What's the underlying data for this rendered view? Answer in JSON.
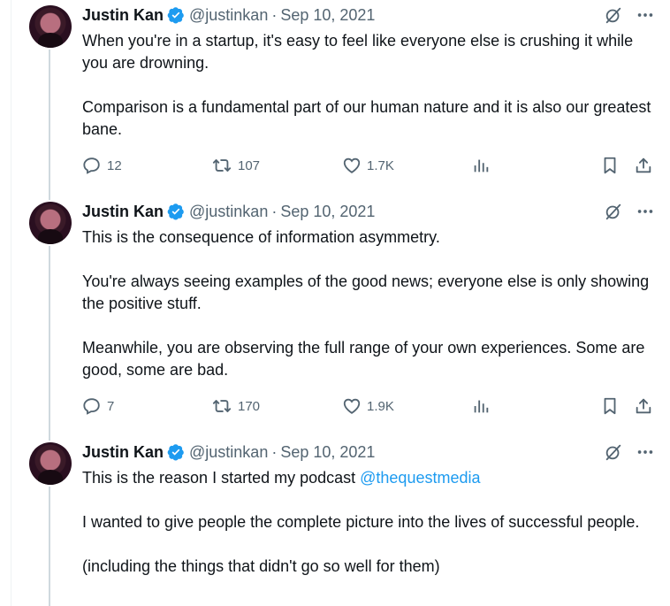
{
  "tweets": [
    {
      "author_name": "Justin Kan",
      "handle": "@justinkan",
      "separator": "·",
      "date": "Sep 10, 2021",
      "paragraphs": [
        "When you're in a startup, it's easy to feel like everyone else is crushing it while you are drowning.",
        "Comparison is a fundamental part of our human nature and it is also our greatest bane."
      ],
      "replies": "12",
      "reposts": "107",
      "likes": "1.7K"
    },
    {
      "author_name": "Justin Kan",
      "handle": "@justinkan",
      "separator": "·",
      "date": "Sep 10, 2021",
      "paragraphs": [
        "This is the consequence of information asymmetry.",
        "You're always seeing examples of the good news; everyone else is only showing the positive stuff.",
        "Meanwhile, you are observing the full range of your own experiences. Some are good, some are bad."
      ],
      "replies": "7",
      "reposts": "170",
      "likes": "1.9K"
    },
    {
      "author_name": "Justin Kan",
      "handle": "@justinkan",
      "separator": "·",
      "date": "Sep 10, 2021",
      "paragraph_1_prefix": "This is the reason I started my podcast ",
      "mention": "@thequestmedia",
      "paragraphs": [
        "I wanted to give people the complete picture into the lives of successful people.",
        "(including the things that didn't go so well for them)"
      ]
    }
  ],
  "icons": {
    "verified": "verified-badge-icon",
    "grok": "grok-icon",
    "more": "more-icon",
    "reply": "reply-icon",
    "repost": "repost-icon",
    "like": "heart-icon",
    "views": "analytics-icon",
    "bookmark": "bookmark-icon",
    "share": "share-icon"
  },
  "colors": {
    "text": "#0f1419",
    "muted": "#536471",
    "verified": "#1d9bf0",
    "mention": "#1d9bf0",
    "thread_line": "#cfd9de"
  }
}
